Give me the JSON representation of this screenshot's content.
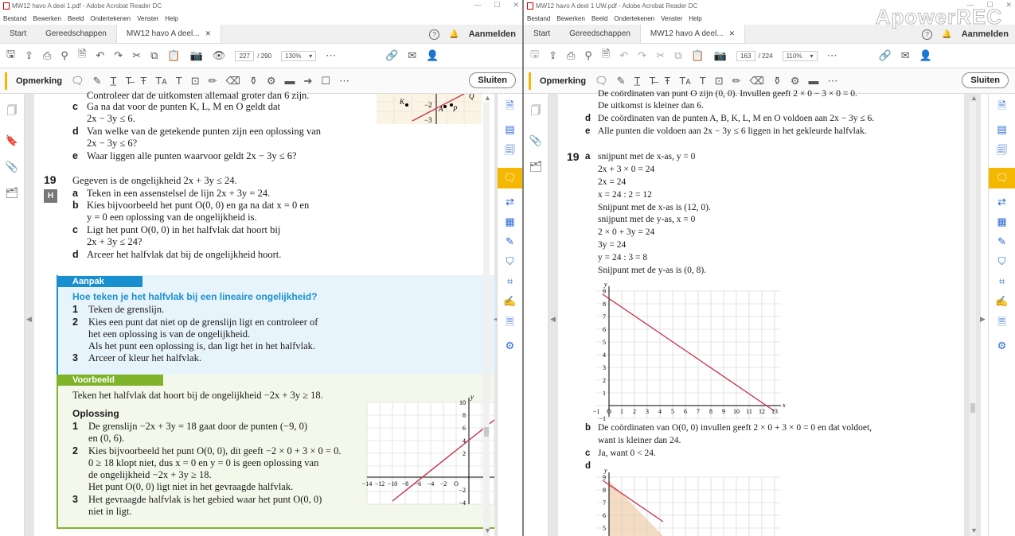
{
  "watermark": "ApowerREC",
  "w1": {
    "title": "MW12 havo A deel 1.pdf - Adobe Acrobat Reader DC",
    "menu": [
      "Bestand",
      "Bewerken",
      "Beeld",
      "Ondertekenen",
      "Venster",
      "Help"
    ],
    "tabs": [
      "Start",
      "Gereedschappen",
      "MW12 havo A deel..."
    ],
    "login": "Aanmelden",
    "page_current": "227",
    "page_total": "/ 290",
    "zoom": "130%",
    "comment_label": "Opmerking",
    "close_label": "Sluiten",
    "content": {
      "l0": "Controleer dat de uitkomsten allemaal groter dan 6 zijn.",
      "c": "c",
      "c1": "Ga na dat voor de punten K, L, M en O geldt dat",
      "c2": "2x − 3y ≤ 6.",
      "d": "d",
      "d1": "Van welke van de getekende punten zijn een oplossing van",
      "d2": "2x − 3y ≤ 6?",
      "e": "e",
      "e1": "Waar liggen alle punten waarvoor geldt 2x − 3y ≤ 6?",
      "q19": "19",
      "badge": "H",
      "q19t": "Gegeven is de ongelijkheid 2x + 3y ≤ 24.",
      "a": "a",
      "a1": "Teken in een assenstelsel de lijn 2x + 3y = 24.",
      "b": "b",
      "b1": "Kies bijvoorbeeld het punt O(0, 0) en ga na dat x = 0 en",
      "b2": "y = 0 een oplossing van de ongelijkheid is.",
      "cc": "c",
      "cc1": "Ligt het punt O(0, 0) in het halfvlak dat hoort bij",
      "cc2": "2x + 3y ≤ 24?",
      "dd": "d",
      "dd1": "Arceer het halfvlak dat bij de ongelijkheid hoort.",
      "aanpak": "Aanpak",
      "aanpak_q": "Hoe teken je het halfvlak bij een lineaire ongelijkheid?",
      "s1": "1",
      "s1t": "Teken de grenslijn.",
      "s2": "2",
      "s2t": "Kies een punt dat niet op de grenslijn ligt en controleer of",
      "s2t2": "het een oplossing is van de ongelijkheid.",
      "s2t3": "Als het punt een oplossing is, dan ligt het in het halfvlak.",
      "s3": "3",
      "s3t": "Arceer of kleur het halfvlak.",
      "voorbeeld": "Voorbeeld",
      "vb": "Teken het halfvlak dat hoort bij de ongelijkheid −2x + 3y ≥ 18.",
      "oplossing": "Oplossing",
      "o1": "1",
      "o1t": "De grenslijn −2x + 3y = 18 gaat door de punten (−9, 0)",
      "o1t2": "en (0, 6).",
      "o2": "2",
      "o2t": "Kies bijvoorbeeld het punt O(0, 0), dit geeft −2 × 0 + 3 × 0 = 0.",
      "o2t2": "0 ≥ 18 klopt niet, dus x = 0 en y = 0 is geen oplossing van",
      "o2t3": "de ongelijkheid −2x + 3y ≥ 18.",
      "o2t4": "Het punt O(0, 0) ligt niet in het gevraagde halfvlak.",
      "o3": "3",
      "o3t": "Het gevraagde halfvlak is het gebied waar het punt O(0, 0)",
      "o3t2": "niet in ligt."
    },
    "mini": {
      "k": "K",
      "a": "A",
      "p": "P",
      "q": "Q",
      "m2": "−2",
      "m3": "−3"
    },
    "chart": {
      "yl": "y",
      "xticks": [
        "−14",
        "−12",
        "−10",
        "−8",
        "−6",
        "−4",
        "−2",
        "O"
      ],
      "yticks": [
        "10",
        "8",
        "6",
        "4",
        "2",
        "−2",
        "−4"
      ]
    }
  },
  "w2": {
    "title": "MW12 havo A deel 1 UW.pdf - Adobe Acrobat Reader DC",
    "menu": [
      "Bestand",
      "Bewerken",
      "Beeld",
      "Ondertekenen",
      "Venster",
      "Help"
    ],
    "tabs": [
      "Start",
      "Gereedschappen",
      "MW12 havo A deel..."
    ],
    "login": "Aanmelden",
    "page_current": "163",
    "page_total": "/ 224",
    "zoom": "110%",
    "comment_label": "Opmerking",
    "close_label": "Sluiten",
    "content": {
      "l0": "De coördinaten van punt O zijn (0, 0). Invullen geeft 2 × 0 − 3 × 0 = 0.",
      "l1": "De uitkomst is kleiner dan 6.",
      "d": "d",
      "d1": "De coördinaten van de punten A, B, K, L, M en O voldoen aan 2x − 3y ≤ 6.",
      "e": "e",
      "e1": "Alle punten die voldoen aan 2x − 3y ≤ 6 liggen in het gekleurde halfvlak.",
      "q19": "19",
      "a": "a",
      "r1": "snijpunt met de x-as, y = 0",
      "r2": "2x + 3 × 0 = 24",
      "r3": "2x = 24",
      "r4": "x = 24 : 2 = 12",
      "r5": "Snijpunt met de x-as is (12, 0).",
      "r6": "snijpunt met de y-as, x = 0",
      "r7": "2 × 0 + 3y = 24",
      "r8": "3y = 24",
      "r9": "y = 24 : 3 = 8",
      "r10": "Snijpunt met de y-as is (0, 8).",
      "b": "b",
      "b1": "De coördinaten van O(0, 0) invullen geeft 2 × 0 + 3 × 0 = 0 en dat voldoet,",
      "b2": "want is kleiner dan 24.",
      "c": "c",
      "c1": "Ja, want 0 < 24.",
      "dd": "d"
    },
    "chart1": {
      "yl": "y",
      "xl": "x",
      "xticks": [
        "−1",
        "O",
        "1",
        "2",
        "3",
        "4",
        "5",
        "6",
        "7",
        "8",
        "9",
        "10",
        "11",
        "12",
        "13"
      ],
      "yticks": [
        "9",
        "8",
        "7",
        "6",
        "5",
        "4",
        "3",
        "2",
        "1",
        "−1"
      ]
    },
    "chart2": {
      "yl": "y",
      "yticks": [
        "9",
        "8",
        "7",
        "6",
        "5"
      ]
    }
  },
  "colors": {
    "accent": "#1a8fd0",
    "green": "#7fb32a",
    "line": "#c8304a",
    "highlight": "#f5b800"
  }
}
